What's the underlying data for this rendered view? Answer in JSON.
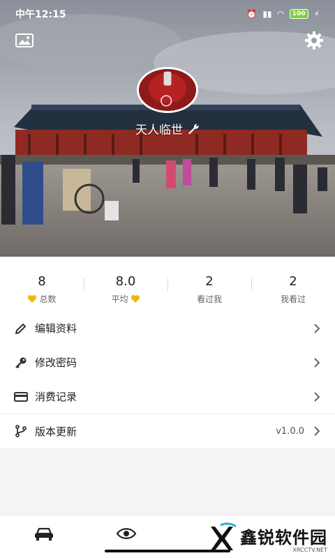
{
  "status_bar": {
    "time": "中午12:15",
    "battery": "100"
  },
  "profile": {
    "username": "天人临世"
  },
  "stats": [
    {
      "value": "8",
      "label": "总数",
      "heart": "before"
    },
    {
      "value": "8.0",
      "label": "平均",
      "heart": "after"
    },
    {
      "value": "2",
      "label": "看过我",
      "heart": "none"
    },
    {
      "value": "2",
      "label": "我看过",
      "heart": "none"
    }
  ],
  "menu": [
    {
      "label": "编辑资料",
      "icon": "pencil-icon"
    },
    {
      "label": "修改密码",
      "icon": "key-icon"
    },
    {
      "label": "消费记录",
      "icon": "card-icon"
    },
    {
      "label": "版本更新",
      "icon": "branch-icon",
      "value": "v1.0.0"
    }
  ],
  "watermark": {
    "title": "鑫锐软件园",
    "subtitle": "XRCCTV.NET"
  },
  "colors": {
    "heart": "#f5b800",
    "accent": "#2ab3c9"
  }
}
